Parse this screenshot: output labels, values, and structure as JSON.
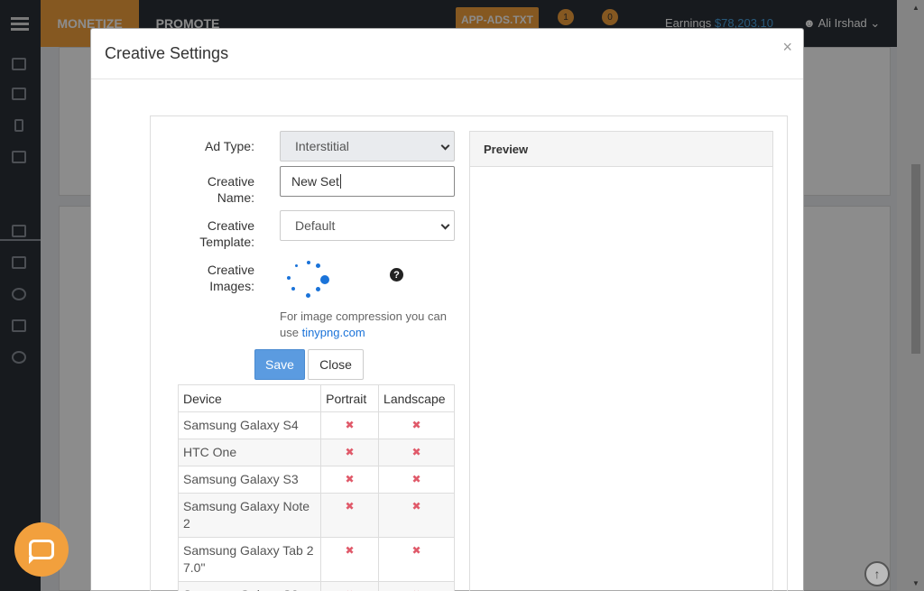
{
  "topbar": {
    "nav_monetize": "MONETIZE",
    "nav_promote": "PROMOTE",
    "app_ads_button": "APP-ADS.TXT",
    "badge_notifications": "1",
    "badge_messages": "0",
    "earnings_label": "Earnings",
    "earnings_value": "$78,203.10",
    "user_name": "Ali Irshad"
  },
  "modal": {
    "title": "Creative Settings",
    "close_glyph": "×",
    "form": {
      "ad_type_label": "Ad Type:",
      "ad_type_value": "Interstitial",
      "creative_name_label_1": "Creative",
      "creative_name_label_2": "Name:",
      "creative_name_value": "New Set",
      "creative_template_label_1": "Creative",
      "creative_template_label_2": "Template:",
      "creative_template_value": "Default",
      "creative_images_label_1": "Creative",
      "creative_images_label_2": "Images:",
      "help_glyph": "?",
      "hint_text": "For image compression you can use ",
      "hint_link": "tinypng.com"
    },
    "buttons": {
      "save": "Save",
      "close": "Close"
    },
    "table": {
      "headers": [
        "Device",
        "Portrait",
        "Landscape"
      ],
      "rows": [
        {
          "device": "Samsung Galaxy S4",
          "portrait": "✖",
          "landscape": "✖"
        },
        {
          "device": "HTC One",
          "portrait": "✖",
          "landscape": "✖"
        },
        {
          "device": "Samsung Galaxy S3",
          "portrait": "✖",
          "landscape": "✖"
        },
        {
          "device": "Samsung Galaxy Note 2",
          "portrait": "✖",
          "landscape": "✖"
        },
        {
          "device": "Samsung Galaxy Tab 2 7.0\"",
          "portrait": "✖",
          "landscape": "✖"
        },
        {
          "device": "Samsung Galaxy S2",
          "portrait": "✖",
          "landscape": "✖"
        }
      ]
    },
    "preview_title": "Preview"
  },
  "colors": {
    "accent_orange": "#f2a03d",
    "primary_blue": "#5b9be0",
    "link_blue": "#1a73d9",
    "error_red": "#e05a6a"
  }
}
